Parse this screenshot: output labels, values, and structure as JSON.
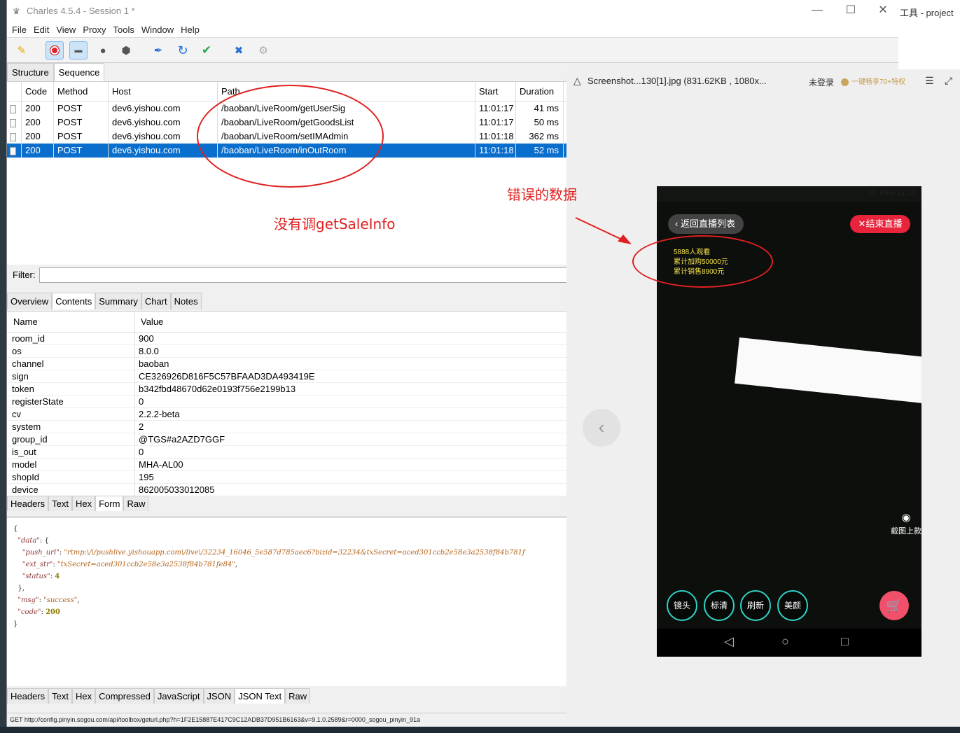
{
  "bg": {
    "right_title": "工具 - project"
  },
  "window": {
    "title": "Charles 4.5.4 - Session 1 *",
    "min": "—",
    "max": "☐",
    "close": "✕"
  },
  "menu": [
    "File",
    "Edit",
    "View",
    "Proxy",
    "Tools",
    "Window",
    "Help"
  ],
  "view_tabs": [
    "Structure",
    "Sequence"
  ],
  "request_table": {
    "headers": [
      "Code",
      "Method",
      "Host",
      "Path",
      "Start",
      "Duration"
    ],
    "rows": [
      {
        "code": "200",
        "method": "POST",
        "host": "dev6.yishou.com",
        "path": "/baoban/LiveRoom/getUserSig",
        "start": "11:01:17",
        "duration": "41 ms"
      },
      {
        "code": "200",
        "method": "POST",
        "host": "dev6.yishou.com",
        "path": "/baoban/LiveRoom/getGoodsList",
        "start": "11:01:17",
        "duration": "50 ms"
      },
      {
        "code": "200",
        "method": "POST",
        "host": "dev6.yishou.com",
        "path": "/baoban/LiveRoom/setIMAdmin",
        "start": "11:01:18",
        "duration": "362 ms"
      },
      {
        "code": "200",
        "method": "POST",
        "host": "dev6.yishou.com",
        "path": "/baoban/LiveRoom/inOutRoom",
        "start": "11:01:18",
        "duration": "52 ms"
      }
    ]
  },
  "filter": {
    "label": "Filter:"
  },
  "detail_tabs": [
    "Overview",
    "Contents",
    "Summary",
    "Chart",
    "Notes"
  ],
  "form_table": {
    "headers": [
      "Name",
      "Value"
    ],
    "rows": [
      {
        "name": "room_id",
        "value": "900"
      },
      {
        "name": "os",
        "value": "8.0.0"
      },
      {
        "name": "channel",
        "value": "baoban"
      },
      {
        "name": "sign",
        "value": "CE326926D816F5C57BFAAD3DA493419E"
      },
      {
        "name": "token",
        "value": "b342fbd48670d62e0193f756e2199b13"
      },
      {
        "name": "registerState",
        "value": "0"
      },
      {
        "name": "cv",
        "value": "2.2.2-beta"
      },
      {
        "name": "system",
        "value": "2"
      },
      {
        "name": "group_id",
        "value": "@TGS#a2AZD7GGF"
      },
      {
        "name": "is_out",
        "value": "0"
      },
      {
        "name": "model",
        "value": "MHA-AL00"
      },
      {
        "name": "shopId",
        "value": "195"
      },
      {
        "name": "device",
        "value": "862005033012085"
      }
    ]
  },
  "request_subtabs": [
    "Headers",
    "Text",
    "Hex",
    "Form",
    "Raw"
  ],
  "response_subtabs": [
    "Headers",
    "Text",
    "Hex",
    "Compressed",
    "JavaScript",
    "JSON",
    "JSON Text",
    "Raw"
  ],
  "json_text": {
    "push_url": "\"rtmp:\\/\\/pushlive.yishouapp.com\\/live\\/32234_16046_5e587d785aec6?bizid=32234&txSecret=aced301ccb2e58e3a2538f84b781f",
    "ext_str": "\"txSecret=aced301ccb2e58e3a2538f84b781fe84\"",
    "status": "4",
    "msg": "\"success\"",
    "code": "200"
  },
  "status_bar": "GET http://config.pinyin.sogou.com/api/toolbox/geturl.php?h=1F2E15887E417C9C12ADB37D951B6163&v=9.1.0.2589&r=0000_sogou_pinyin_91a",
  "annotations": {
    "no_call": "没有调getSaleInfo",
    "wrong_data": "错误的数据"
  },
  "viewer": {
    "title": "Screenshot...130[1].jpg (831.62KB , 1080x...",
    "login": "未登录",
    "promo": "一键畅享70+特权"
  },
  "phone": {
    "status_right": "4G 85% 11:01",
    "back": "返回直播列表",
    "end": "结束直播",
    "stats": [
      "5888人观看",
      "累计加购50000元",
      "累计销售8900元"
    ],
    "snap": "截图上款",
    "controls": [
      "镜头",
      "标清",
      "刷新",
      "美颜"
    ]
  },
  "colors": {
    "selection": "#0a6ecd",
    "annotation": "#e02020",
    "end_button": "#e8243c",
    "control_ring": "#2fd1c7"
  }
}
